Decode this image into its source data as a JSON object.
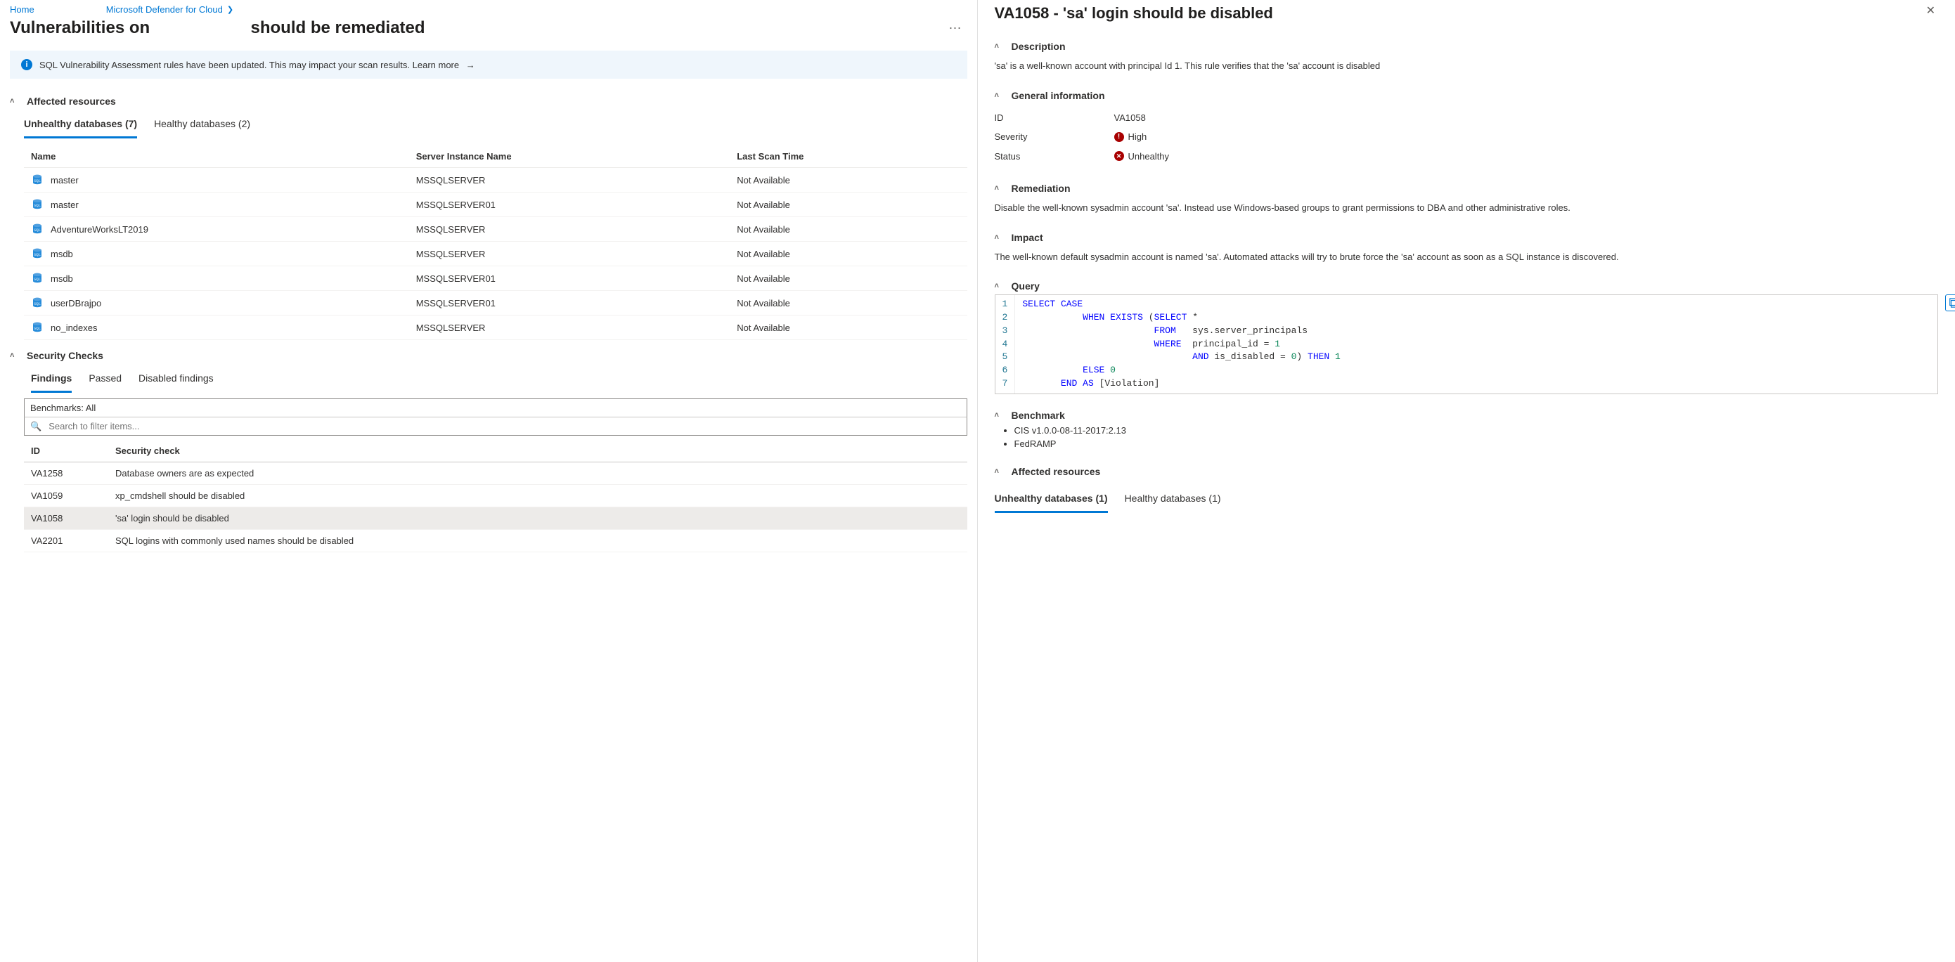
{
  "breadcrumb": {
    "home": "Home",
    "defender": "Microsoft Defender for Cloud"
  },
  "page_title_left": "Vulnerabilities on",
  "page_title_right": "should be remediated",
  "banner": {
    "text": "SQL Vulnerability Assessment rules have been updated. This may impact your scan results.",
    "learn": "Learn more"
  },
  "sections": {
    "affected": "Affected resources",
    "security_checks": "Security Checks"
  },
  "db_tabs": {
    "unhealthy": "Unhealthy databases (7)",
    "healthy": "Healthy databases (2)"
  },
  "db_cols": {
    "name": "Name",
    "server": "Server Instance Name",
    "scan": "Last Scan Time"
  },
  "db_rows": [
    {
      "name": "master",
      "server": "MSSQLSERVER",
      "scan": "Not Available"
    },
    {
      "name": "master",
      "server": "MSSQLSERVER01",
      "scan": "Not Available"
    },
    {
      "name": "AdventureWorksLT2019",
      "server": "MSSQLSERVER",
      "scan": "Not Available"
    },
    {
      "name": "msdb",
      "server": "MSSQLSERVER",
      "scan": "Not Available"
    },
    {
      "name": "msdb",
      "server": "MSSQLSERVER01",
      "scan": "Not Available"
    },
    {
      "name": "userDBrajpo",
      "server": "MSSQLSERVER01",
      "scan": "Not Available"
    },
    {
      "name": "no_indexes",
      "server": "MSSQLSERVER",
      "scan": "Not Available"
    }
  ],
  "check_tabs": {
    "findings": "Findings",
    "passed": "Passed",
    "disabled": "Disabled findings"
  },
  "bench_value": "Benchmarks: All",
  "search_placeholder": "Search to filter items...",
  "check_cols": {
    "id": "ID",
    "sc": "Security check"
  },
  "check_rows": [
    {
      "id": "VA1258",
      "sc": "Database owners are as expected",
      "sel": false
    },
    {
      "id": "VA1059",
      "sc": "xp_cmdshell should be disabled",
      "sel": false
    },
    {
      "id": "VA1058",
      "sc": "'sa' login should be disabled",
      "sel": true
    },
    {
      "id": "VA2201",
      "sc": "SQL logins with commonly used names should be disabled",
      "sel": false
    }
  ],
  "detail": {
    "title": "VA1058 - 'sa' login should be disabled",
    "desc_hdr": "Description",
    "desc": "'sa' is a well-known account with principal Id 1. This rule verifies that the 'sa' account is disabled",
    "gen_hdr": "General information",
    "id_label": "ID",
    "id_val": "VA1058",
    "sev_label": "Severity",
    "sev_val": "High",
    "stat_label": "Status",
    "stat_val": "Unhealthy",
    "rem_hdr": "Remediation",
    "rem": "Disable the well-known sysadmin account 'sa'. Instead use Windows-based groups to grant permissions to DBA and other administrative roles.",
    "imp_hdr": "Impact",
    "imp": "The well-known default sysadmin account is named 'sa'. Automated attacks will try to brute force the 'sa' account as soon as a SQL instance is discovered.",
    "query_hdr": "Query",
    "bench_hdr": "Benchmark",
    "bench_items": [
      "CIS v1.0.0-08-11-2017:2.13",
      "FedRAMP"
    ],
    "aff_hdr": "Affected resources",
    "aff_tabs": {
      "unhealthy": "Unhealthy databases (1)",
      "healthy": "Healthy databases (1)"
    }
  }
}
